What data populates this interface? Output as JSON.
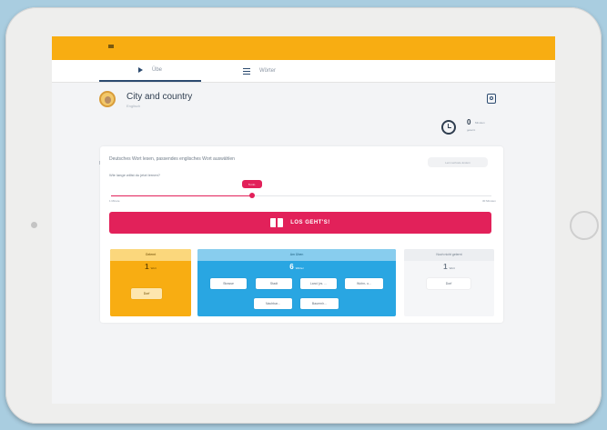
{
  "app": {
    "tabs": [
      {
        "label": "Übe",
        "icon": "play-icon"
      },
      {
        "label": "Wörter",
        "icon": "list-icon"
      }
    ]
  },
  "lesson": {
    "title": "City and country",
    "subtitle": "Englisch",
    "level": "B1",
    "time_value": "0",
    "time_unit": "Minuten",
    "time_label": "gelernt"
  },
  "exercise": {
    "instruction": "Deutsches Wort lesen, passendes englisches Wort auswählen",
    "question": "Wie lange willst du jetzt lernen?",
    "hint_label": "Lernmethode ändern",
    "slider_value_label": "5 min",
    "slider_value_fraction": 0.37,
    "slider_min": "1 Minute",
    "slider_max": "30 Minuten",
    "go_label": "LOS GEHT'S!"
  },
  "boxes": {
    "learned": {
      "title": "Gelernt",
      "count": "1",
      "unit": "Wort",
      "chips": [
        "Dorf"
      ]
    },
    "learning": {
      "title": "Am Üben",
      "count": "6",
      "unit": "Wörter",
      "chips": [
        "Strasse",
        "Stadt",
        "Land (vs. ...",
        "Wohn- o...",
        "Nachbar...",
        "Bauernh..."
      ]
    },
    "unknown": {
      "title": "Noch nicht gelernt",
      "count": "1",
      "unit": "Wort",
      "chips": [
        "Dorf"
      ]
    }
  },
  "colors": {
    "accent": "#e2215a",
    "brand": "#f8ad12",
    "learning": "#29a6e2"
  }
}
